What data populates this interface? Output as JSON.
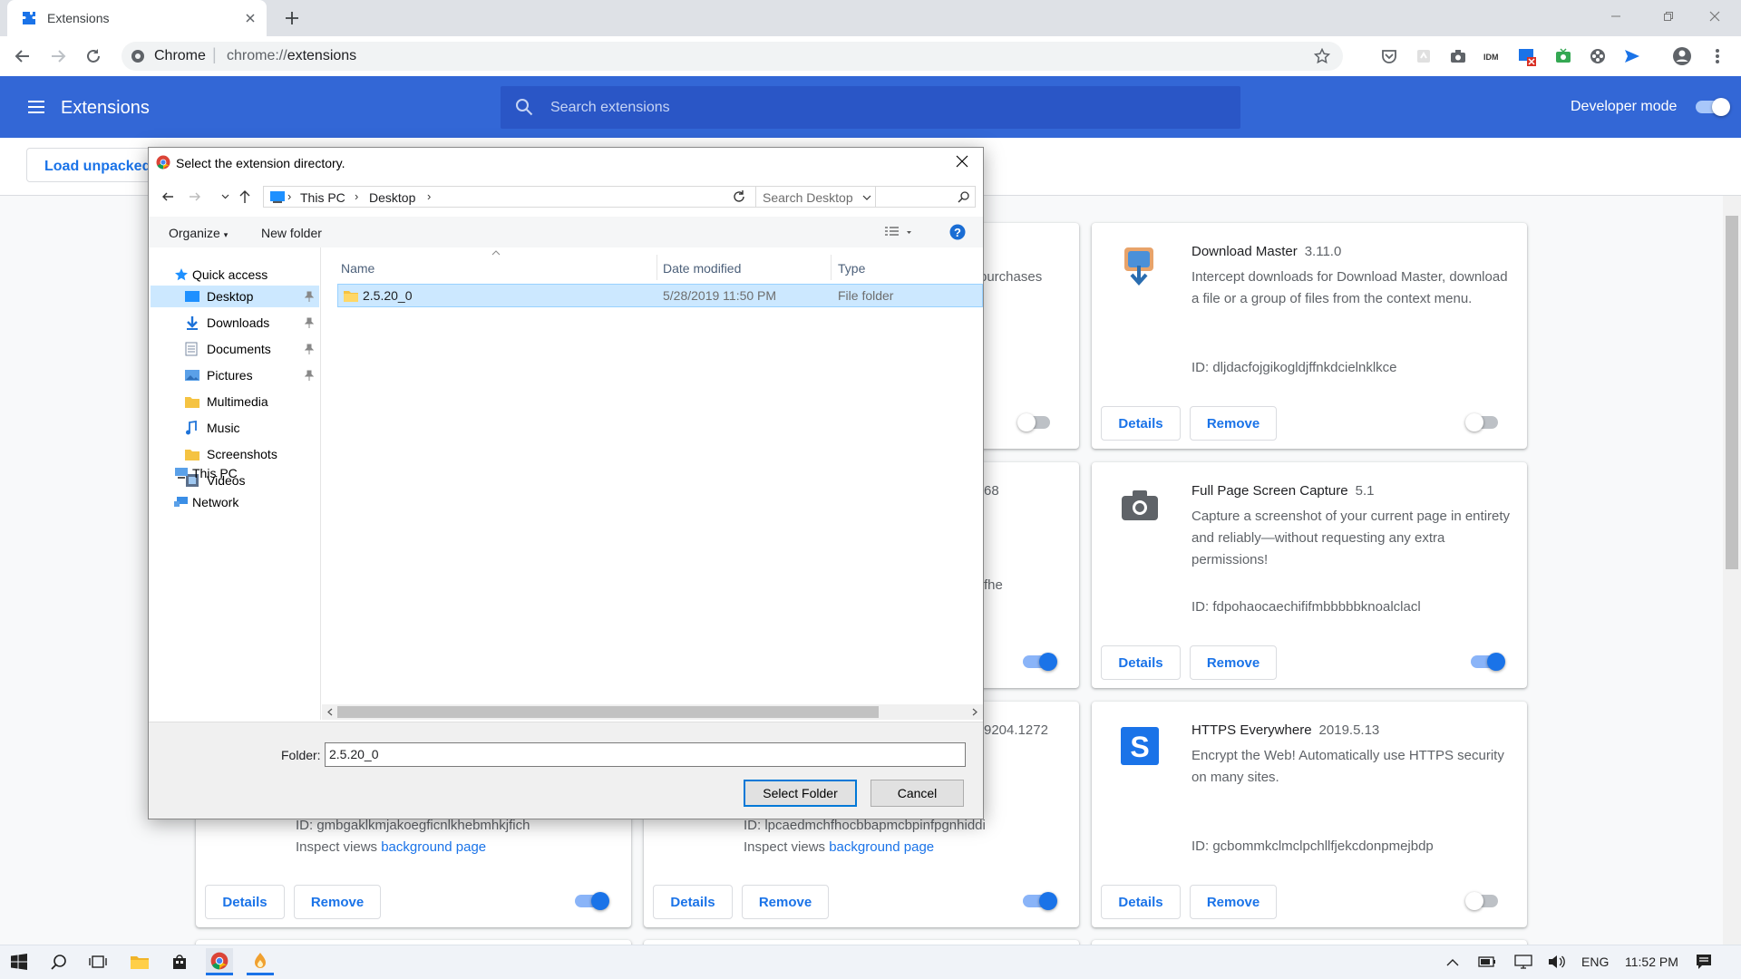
{
  "tab": {
    "title": "Extensions"
  },
  "omnibox": {
    "site": "Chrome",
    "url_prefix": "chrome://",
    "url_path": "extensions"
  },
  "header": {
    "title": "Extensions",
    "search_placeholder": "Search extensions",
    "developer_mode_label": "Developer mode",
    "developer_mode_on": true
  },
  "subbar": {
    "load_unpacked": "Load unpacked"
  },
  "cards": {
    "hidden_partial": {
      "purchases": "purchases",
      "v68": "68",
      "fhe": "fhe",
      "v9204": "9204.1272"
    },
    "download_master": {
      "name": "Download Master",
      "version": "3.11.0",
      "description": "Intercept downloads for Download Master, download a file or a group of files from the context menu.",
      "id": "ID: dljdacfojgikogldjffnkdcielnklkce",
      "enabled": false
    },
    "full_page": {
      "name": "Full Page Screen Capture",
      "version": "5.1",
      "description": "Capture a screenshot of your current page in entirety and reliably—without requesting any extra permissions!",
      "id": "ID: fdpohaocaechififmbbbbbknoalclacl",
      "enabled": true
    },
    "https_everywhere": {
      "name": "HTTPS Everywhere",
      "version": "2019.5.13",
      "description": "Encrypt the Web! Automatically use HTTPS security on many sites.",
      "id": "ID: gcbommkclmclpchllfjekcdonpmejbdp",
      "enabled": false
    },
    "bottom_left": {
      "id": "ID: gmbgaklkmjakoegficnlkhebmhkjfich",
      "inspect": "Inspect views",
      "inspect_link": "background page",
      "enabled": true
    },
    "bottom_mid": {
      "id": "ID: lpcaedmchfhocbbapmcbpinfpgnhiddi",
      "inspect": "Inspect views",
      "inspect_link": "background page",
      "enabled": true
    },
    "details_label": "Details",
    "remove_label": "Remove"
  },
  "dialog": {
    "title": "Select the extension directory.",
    "breadcrumb": [
      "This PC",
      "Desktop"
    ],
    "search_placeholder": "Search Desktop",
    "organize": "Organize",
    "new_folder": "New folder",
    "nav": {
      "quick_access": "Quick access",
      "items": [
        "Desktop",
        "Downloads",
        "Documents",
        "Pictures",
        "Multimedia",
        "Music",
        "Screenshots",
        "Videos"
      ],
      "this_pc": "This PC",
      "network": "Network"
    },
    "columns": {
      "name": "Name",
      "date": "Date modified",
      "type": "Type"
    },
    "files": [
      {
        "name": "2.5.20_0",
        "date": "5/28/2019 11:50 PM",
        "type": "File folder"
      }
    ],
    "folder_label": "Folder:",
    "folder_value": "2.5.20_0",
    "select_button": "Select Folder",
    "cancel_button": "Cancel"
  },
  "taskbar": {
    "lang": "ENG",
    "time": "11:52 PM"
  },
  "colors": {
    "brand_blue": "#3367d6",
    "accent": "#1a73e8",
    "selection": "#cce8ff"
  }
}
